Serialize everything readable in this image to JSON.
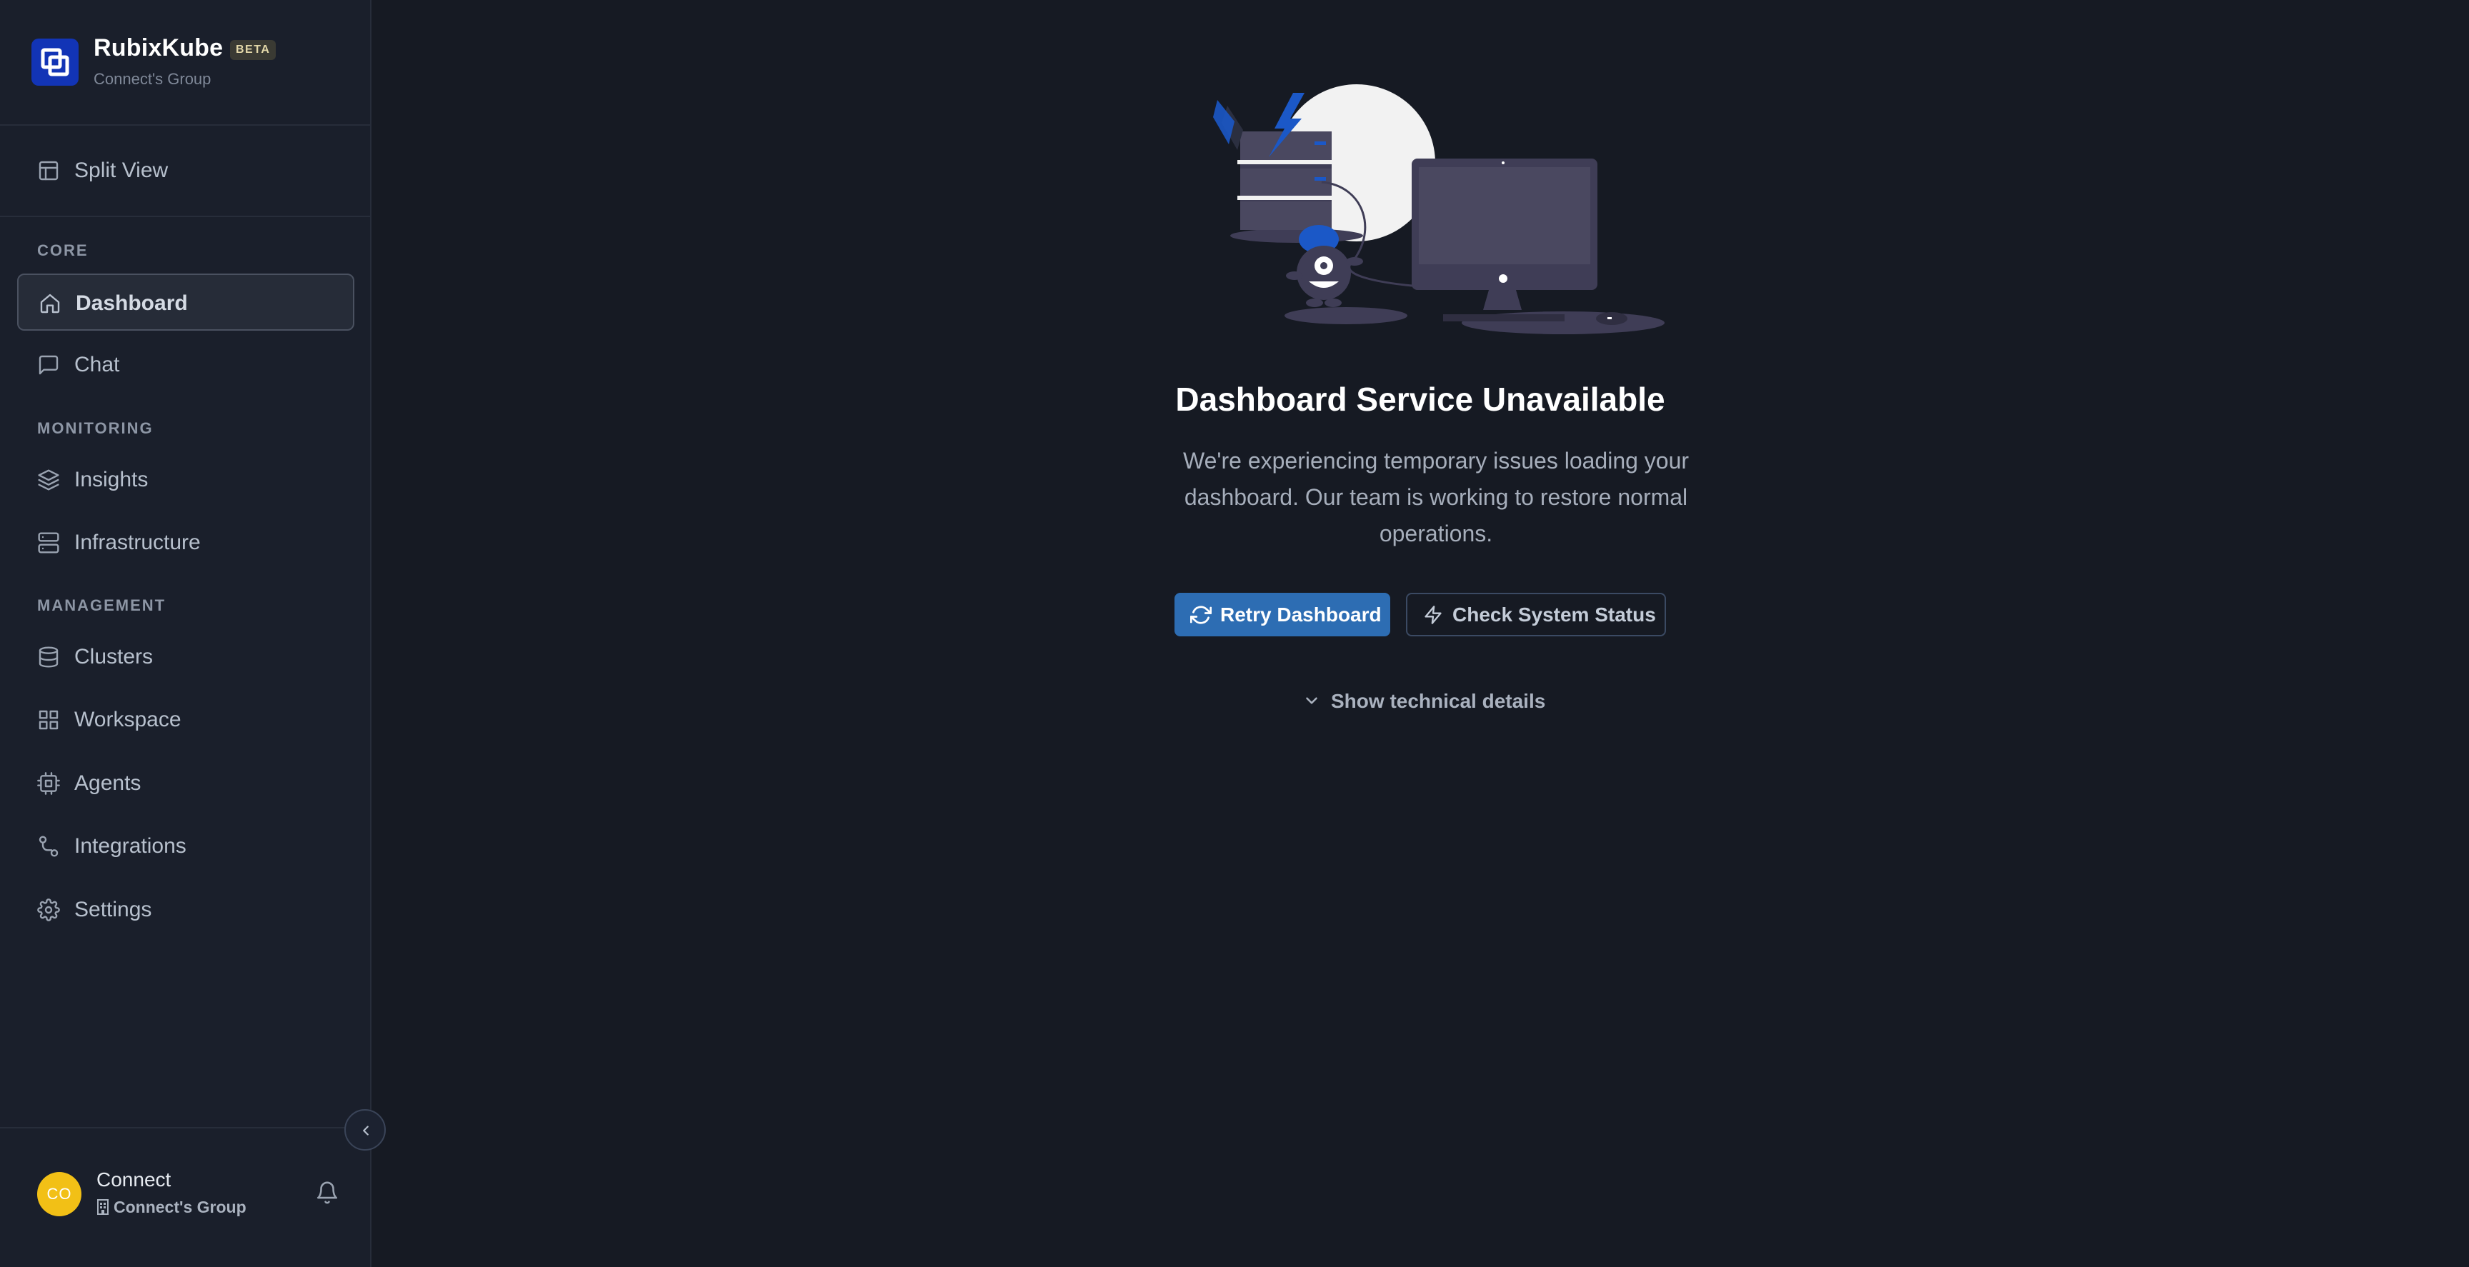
{
  "brand": {
    "name": "RubixKube",
    "badge": "BETA",
    "subtitle": "Connect's Group",
    "logo_color": "#1234b6"
  },
  "sidebar": {
    "top_items": [
      {
        "label": "Split View",
        "icon": "split-view-icon"
      }
    ],
    "sections": [
      {
        "title": "CORE",
        "items": [
          {
            "label": "Dashboard",
            "icon": "home-icon",
            "active": true
          },
          {
            "label": "Chat",
            "icon": "chat-icon"
          }
        ]
      },
      {
        "title": "MONITORING",
        "items": [
          {
            "label": "Insights",
            "icon": "layers-icon"
          },
          {
            "label": "Infrastructure",
            "icon": "server-icon"
          }
        ]
      },
      {
        "title": "MANAGEMENT",
        "items": [
          {
            "label": "Clusters",
            "icon": "database-icon"
          },
          {
            "label": "Workspace",
            "icon": "grid-icon"
          },
          {
            "label": "Agents",
            "icon": "cpu-icon"
          },
          {
            "label": "Integrations",
            "icon": "route-icon"
          },
          {
            "label": "Settings",
            "icon": "gear-icon"
          }
        ]
      }
    ],
    "user": {
      "initials": "CO",
      "name": "Connect",
      "org": "Connect's Group",
      "avatar_color": "#f2c016"
    }
  },
  "main": {
    "title": "Dashboard Service Unavailable",
    "description": "We're experiencing temporary issues loading your dashboard. Our team is working to restore normal operations.",
    "retry_label": "Retry Dashboard",
    "status_label": "Check System Status",
    "details_label": "Show technical details",
    "accent": "#2d6db3"
  }
}
